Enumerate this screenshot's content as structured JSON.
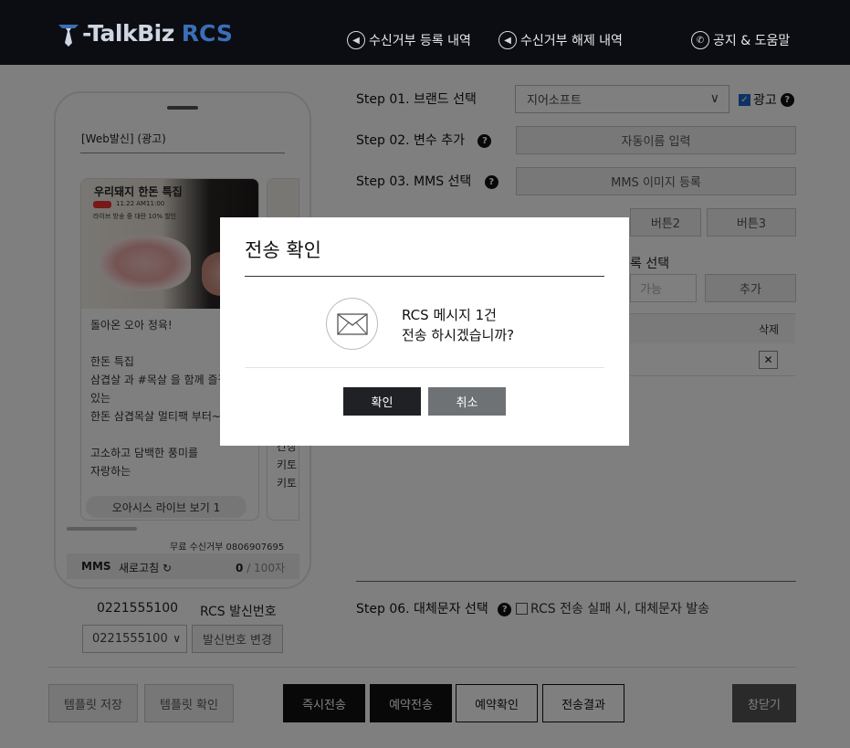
{
  "header": {
    "logo_main": "-TalkBiz",
    "logo_accent": "RCS",
    "nav": [
      {
        "label": "수신거부 등록 내역"
      },
      {
        "label": "수신거부 해제 내역"
      },
      {
        "label": "공지 & 도움말"
      }
    ]
  },
  "preview": {
    "title": "[Web발신] (광고)",
    "card_title": "우리돼지 한돈 특집",
    "card_sub1": "11.22 AM11:00",
    "card_sub2": "라이브 방송 중 대란 10% 할인",
    "card_text": "돌아온 오아 정육!\n\n한돈 특집\n삼겹살 과 #목살 을 함께 즐길 수\n있는\n한돈 삼겹목살 멀티팩 부터~\n\n고소하고 담백한 풍미를\n자랑하는\n한돈 목심세트",
    "card_button": "오아시스 라이브 보기 1",
    "card2_text": "간장\n키토\n키토",
    "optout": "무료 수신거부 0806907695",
    "type": "MMS",
    "refresh": "새로고침 ↻",
    "count": "0",
    "count_total": "/ 100자"
  },
  "sender": {
    "number": "0221555100",
    "label": "RCS 발신번호",
    "select_value": "0221555100",
    "change_button": "발신번호 변경"
  },
  "steps": {
    "s1": "Step 01. 브랜드 선택",
    "s1_value": "지어소프트",
    "s1_ad": "광고",
    "s2": "Step 02. 변수 추가",
    "s2_button": "자동이름 입력",
    "s3": "Step 03. MMS 선택",
    "s3_button": "MMS 이미지 등록",
    "s4_btn2": "버튼2",
    "s4_btn3": "버튼3",
    "s5_label": "록 선택",
    "s5_placeholder": "가능",
    "s5_add": "추가",
    "table_delete": "삭제",
    "s6": "Step 06. 대체문자 선택",
    "s6_check": "RCS 전송 실패 시, 대체문자 발송"
  },
  "bottom": {
    "save_template": "템플릿 저장",
    "check_template": "템플릿 확인",
    "send_now": "즉시전송",
    "send_reserved": "예약전송",
    "check_reserved": "예약확인",
    "send_result": "전송결과",
    "close": "창닫기"
  },
  "modal": {
    "title": "전송 확인",
    "line1": "RCS 메시지 1건",
    "line2": "전송 하시겠습니까?",
    "ok": "확인",
    "cancel": "취소"
  }
}
